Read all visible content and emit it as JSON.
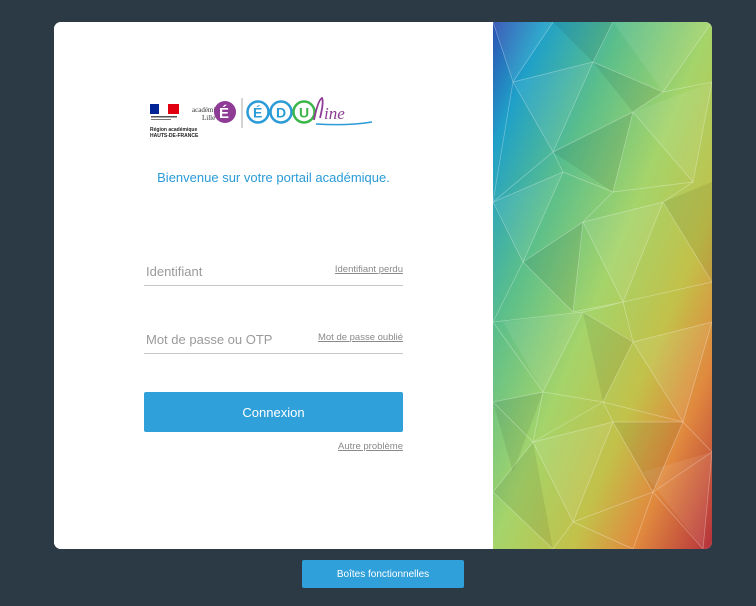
{
  "logo": {
    "region_line1": "Région académique",
    "region_line2": "HAUTS-DE-FRANCE",
    "academie_line1": "académie",
    "academie_line2": "Lille",
    "edu_letters": [
      "É",
      "D",
      "U"
    ],
    "edu_suffix": "ine",
    "colors": {
      "blue": "#2a9bd6",
      "green": "#3cb54a",
      "purple": "#8e3b96",
      "red": "#e1000f",
      "navy": "#002395"
    }
  },
  "welcome": "Bienvenue sur votre portail académique.",
  "login": {
    "identifier_placeholder": "Identifiant",
    "identifier_link": "Identifiant perdu",
    "password_placeholder": "Mot de passe ou OTP",
    "password_link": "Mot de passe oublié",
    "submit_label": "Connexion",
    "other_problem": "Autre problème"
  },
  "footer": {
    "toolbox_label": "Boîtes fonctionnelles"
  },
  "colors": {
    "accent": "#2fa0d9",
    "background": "#2b3a44"
  }
}
